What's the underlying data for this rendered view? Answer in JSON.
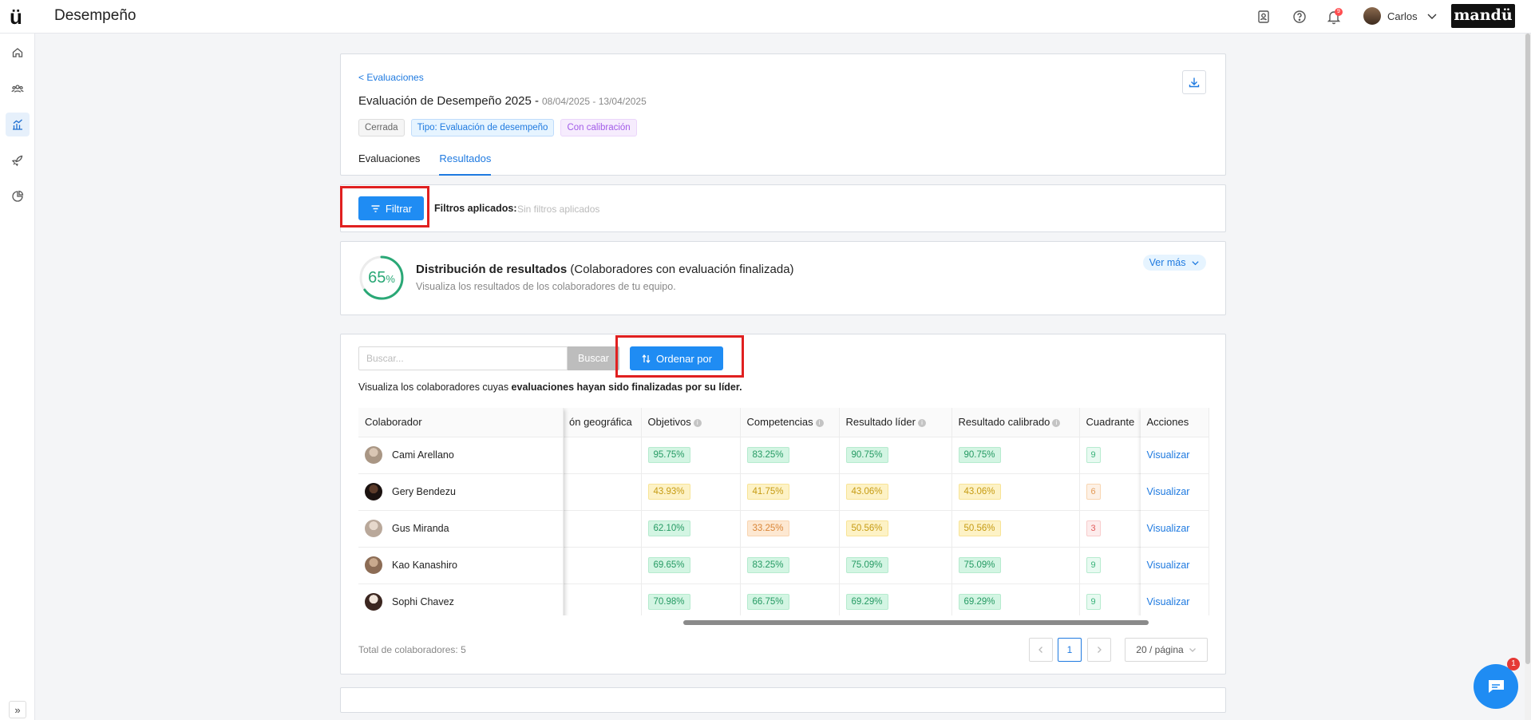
{
  "app": {
    "title": "Desempeño",
    "logo_text": "ü",
    "brand": "mandü",
    "user_name": "Carlos",
    "notification_count": "9"
  },
  "sidebar": {
    "items": [
      {
        "name": "home-icon",
        "active": false
      },
      {
        "name": "team-icon",
        "active": false
      },
      {
        "name": "performance-icon",
        "active": true
      },
      {
        "name": "rocket-icon",
        "active": false
      },
      {
        "name": "pie-chart-icon",
        "active": false
      }
    ],
    "expand_label": "»"
  },
  "header": {
    "breadcrumb": "< Evaluaciones",
    "title": "Evaluación de Desempeño 2025 -",
    "dates": "08/04/2025 - 13/04/2025",
    "tags": [
      "Cerrada",
      "Tipo: Evaluación de desempeño",
      "Con calibración"
    ],
    "tabs": [
      "Evaluaciones",
      "Resultados"
    ],
    "active_tab": "Resultados"
  },
  "filters": {
    "button_label": "Filtrar",
    "applied_label": "Filtros aplicados:",
    "applied_value": "Sin filtros aplicados"
  },
  "distribution": {
    "percent": 65,
    "percent_value": "65",
    "percent_sign": "%",
    "title_bold": "Distribución de resultados",
    "title_rest": " (Colaboradores con evaluación finalizada)",
    "subtitle": "Visualiza los resultados de los colaboradores de tu equipo.",
    "more_label": "Ver más"
  },
  "search": {
    "placeholder": "Buscar...",
    "button_label": "Buscar",
    "sort_label": "Ordenar por"
  },
  "description": {
    "plain": "Visualiza los colaboradores cuyas ",
    "bold": "evaluaciones hayan sido finalizadas por su líder."
  },
  "table": {
    "headers": {
      "collaborator": "Colaborador",
      "geo": "ón geográfica",
      "objectives": "Objetivos",
      "competencies": "Competencias",
      "leader_result": "Resultado líder",
      "calibrated_result": "Resultado calibrado",
      "quadrant": "Cuadrante",
      "actions": "Acciones"
    },
    "rows": [
      {
        "name": "Cami Arellano",
        "objectives": "95.75%",
        "objectives_color": "green",
        "competencies": "83.25%",
        "competencies_color": "green",
        "leader": "90.75%",
        "leader_color": "green",
        "calibrated": "90.75%",
        "calibrated_color": "green",
        "quadrant": "9",
        "quadrant_color": "green",
        "action": "Visualizar"
      },
      {
        "name": "Gery Bendezu",
        "objectives": "43.93%",
        "objectives_color": "yellow",
        "competencies": "41.75%",
        "competencies_color": "yellow",
        "leader": "43.06%",
        "leader_color": "yellow",
        "calibrated": "43.06%",
        "calibrated_color": "yellow",
        "quadrant": "6",
        "quadrant_color": "orange",
        "action": "Visualizar"
      },
      {
        "name": "Gus Miranda",
        "objectives": "62.10%",
        "objectives_color": "green",
        "competencies": "33.25%",
        "competencies_color": "orange",
        "leader": "50.56%",
        "leader_color": "yellow",
        "calibrated": "50.56%",
        "calibrated_color": "yellow",
        "quadrant": "3",
        "quadrant_color": "red",
        "action": "Visualizar"
      },
      {
        "name": "Kao Kanashiro",
        "objectives": "69.65%",
        "objectives_color": "green",
        "competencies": "83.25%",
        "competencies_color": "green",
        "leader": "75.09%",
        "leader_color": "green",
        "calibrated": "75.09%",
        "calibrated_color": "green",
        "quadrant": "9",
        "quadrant_color": "green",
        "action": "Visualizar"
      },
      {
        "name": "Sophi Chavez",
        "objectives": "70.98%",
        "objectives_color": "green",
        "competencies": "66.75%",
        "competencies_color": "green",
        "leader": "69.29%",
        "leader_color": "green",
        "calibrated": "69.29%",
        "calibrated_color": "green",
        "quadrant": "9",
        "quadrant_color": "green",
        "action": "Visualizar"
      }
    ]
  },
  "footer": {
    "total_label": "Total de colaboradores: 5",
    "current_page": "1",
    "page_size": "20 / página"
  },
  "chat": {
    "badge": "1"
  },
  "colors": {
    "accent": "#1f8cf3",
    "highlight": "#e02020",
    "green_text": "#259a63",
    "yellow_text": "#c69b12"
  }
}
